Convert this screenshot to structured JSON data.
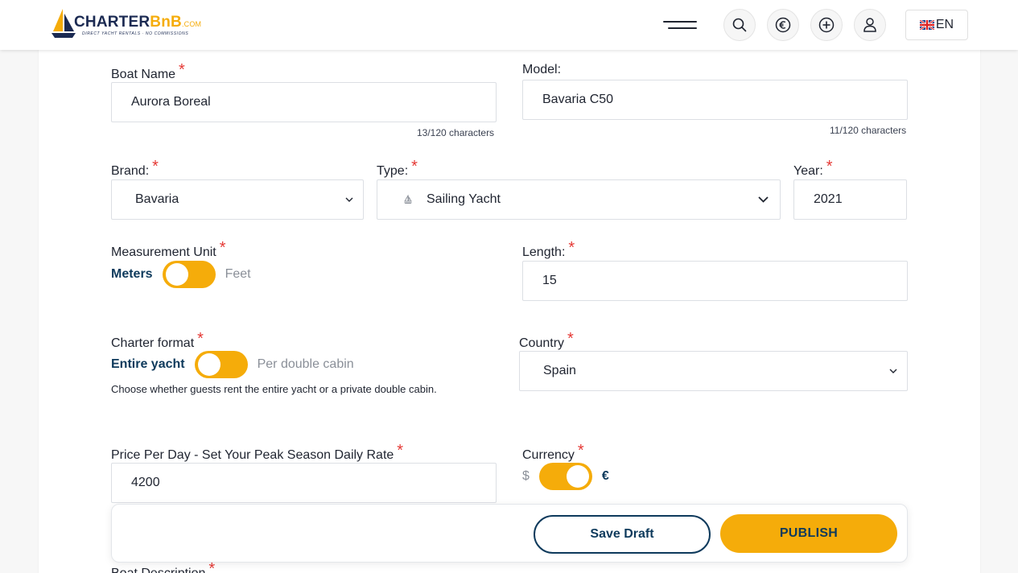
{
  "header": {
    "logo_main": "CHARTER",
    "logo_accent": "BnB",
    "logo_suffix": ".COM",
    "logo_tagline": "DIRECT YACHT RENTALS · NO COMMISSIONS",
    "language_label": "EN",
    "icons": [
      "menu-icon",
      "search-icon",
      "euro-icon",
      "plus-circle-icon",
      "user-icon",
      "uk-flag-icon"
    ]
  },
  "form": {
    "boat_name": {
      "label": "Boat Name",
      "required_mark": "*",
      "value": "Aurora Boreal",
      "counter": "13/120 characters"
    },
    "model": {
      "label": "Model:",
      "value": "Bavaria C50",
      "counter": "11/120 characters"
    },
    "brand": {
      "label": "Brand:",
      "required_mark": "*",
      "value": "Bavaria"
    },
    "type": {
      "label": "Type:",
      "required_mark": "*",
      "value": "Sailing Yacht"
    },
    "year": {
      "label": "Year:",
      "required_mark": "*",
      "value": "2021"
    },
    "measurement_unit": {
      "label": "Measurement Unit",
      "required_mark": "*",
      "option_on": "Meters",
      "option_off": "Feet",
      "selected": "Meters"
    },
    "length": {
      "label": "Length:",
      "required_mark": "*",
      "value": "15"
    },
    "charter_format": {
      "label": "Charter format",
      "required_mark": "*",
      "option_on": "Entire yacht",
      "option_off": "Per double cabin",
      "selected": "Entire yacht",
      "hint": "Choose whether guests rent the entire yacht or a private double cabin."
    },
    "country": {
      "label": "Country",
      "required_mark": "*",
      "value": "Spain"
    },
    "price": {
      "label": "Price Per Day - Set Your Peak Season Daily Rate",
      "required_mark": "*",
      "value": "4200"
    },
    "currency": {
      "label": "Currency",
      "required_mark": "*",
      "option_off": "$",
      "option_on": "€",
      "selected": "€"
    },
    "description": {
      "label": "Boat Description",
      "required_mark": "*"
    }
  },
  "actions": {
    "save_draft": "Save Draft",
    "publish": "PUBLISH"
  },
  "colors": {
    "accent": "#f5ac0a",
    "navy": "#0e3a5c",
    "required": "#e53935"
  }
}
